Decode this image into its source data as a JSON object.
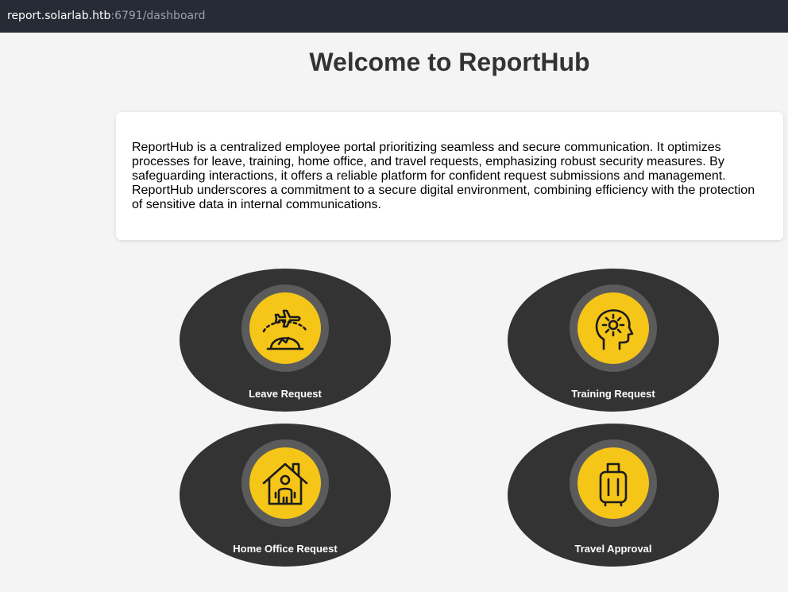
{
  "browser": {
    "url_host": "report.solarlab.htb",
    "url_rest": ":6791/dashboard"
  },
  "page": {
    "title": "Welcome to ReportHub",
    "intro": "ReportHub is a centralized employee portal prioritizing seamless and secure communication. It optimizes processes for leave, training, home office, and travel requests, emphasizing robust security measures. By safeguarding interactions, it offers a reliable platform for confident request submissions and management. ReportHub underscores a commitment to a secure digital environment, combining efficiency with the protection of sensitive data in internal communications."
  },
  "tiles": [
    {
      "label": "Leave Request",
      "icon": "airplane-globe-icon"
    },
    {
      "label": "Training Request",
      "icon": "head-gear-icon"
    },
    {
      "label": "Home Office Request",
      "icon": "house-person-icon"
    },
    {
      "label": "Travel Approval",
      "icon": "luggage-icon"
    }
  ],
  "colors": {
    "tile_bg": "#333333",
    "icon_ring": "#5b5b5b",
    "icon_core": "#f5c518",
    "urlbar_bg": "#272b36"
  }
}
